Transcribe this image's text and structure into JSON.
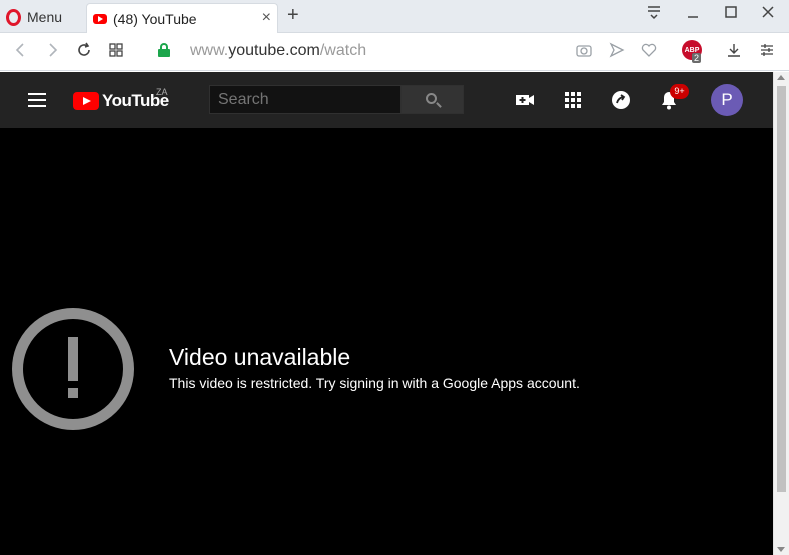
{
  "browser": {
    "menu_label": "Menu",
    "tab_title": "(48) YouTube",
    "tab_close": "×",
    "new_tab": "+",
    "url_prefix": "www.",
    "url_host": "youtube.com",
    "url_path": "/watch",
    "adblock_label": "ABP",
    "adblock_count": "2",
    "accent_color": "#e0162b"
  },
  "youtube": {
    "logo_text": "YouTube",
    "country_code": "ZA",
    "search_placeholder": "Search",
    "notifications_badge": "9+",
    "avatar_letter": "P",
    "avatar_color": "#6b5bb5"
  },
  "message": {
    "title": "Video unavailable",
    "subtitle": "This video is restricted. Try signing in with a Google Apps account."
  }
}
